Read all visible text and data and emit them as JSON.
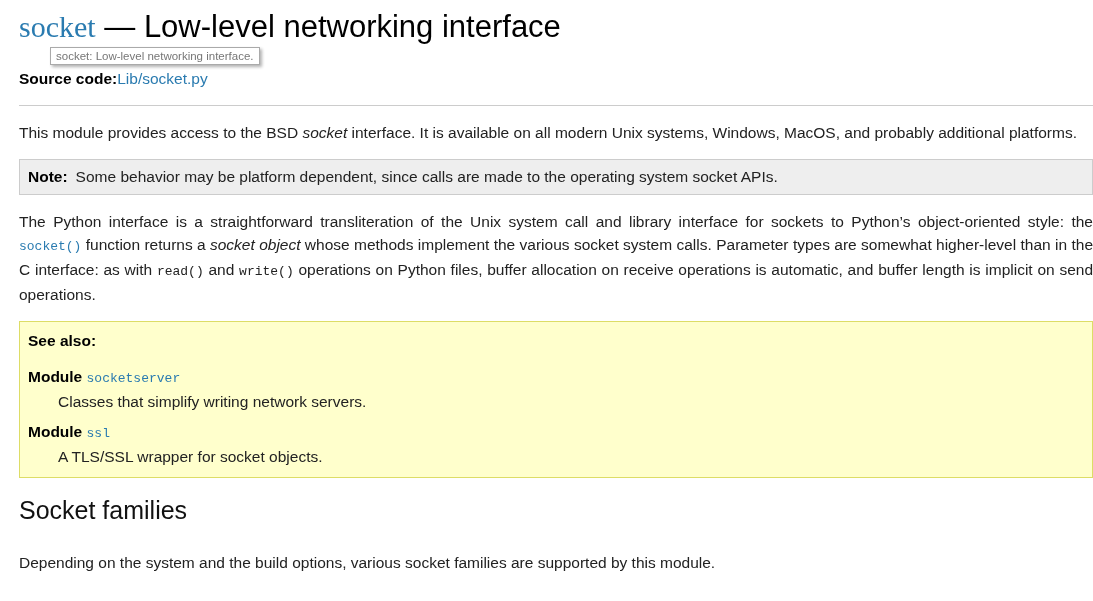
{
  "heading": {
    "module": "socket",
    "rest": "— Low-level networking interface"
  },
  "tooltip": "socket: Low-level networking interface.",
  "source": {
    "label": "Source code:",
    "link": "Lib/socket.py"
  },
  "intro": "This module provides access to the BSD *socket* interface. It is available on all modern Unix systems, Windows, MacOS, and probably additional platforms.",
  "note": {
    "label": "Note:",
    "text": "Some behavior may be platform dependent, since calls are made to the operating system socket APIs."
  },
  "paragraph": [
    {
      "kind": "text",
      "text": "The Python interface is a straightforward transliteration of the Unix system call and library interface for sockets to Python’s object-oriented style: the "
    },
    {
      "kind": "link",
      "text": "socket()"
    },
    {
      "kind": "text",
      "text": " function returns a *socket object* whose methods implement the various socket system calls. Parameter types are somewhat higher-level than in the C interface: as with "
    },
    {
      "kind": "code",
      "text": "read()"
    },
    {
      "kind": "text",
      "text": " and "
    },
    {
      "kind": "code",
      "text": "write()"
    },
    {
      "kind": "text",
      "text": " operations on Python files, buffer allocation on receive operations is automatic, and buffer length is implicit on send operations."
    }
  ],
  "see_also": {
    "title": "See also:",
    "items": [
      {
        "label": "Module",
        "link": "socketserver",
        "description": "Classes that simplify writing network servers."
      },
      {
        "label": "Module",
        "link": "ssl",
        "description": "A TLS/SSL wrapper for socket objects."
      }
    ]
  },
  "section_title": "Socket families",
  "section_text": "Depending on the system and the build options, various socket families are supported by this module."
}
